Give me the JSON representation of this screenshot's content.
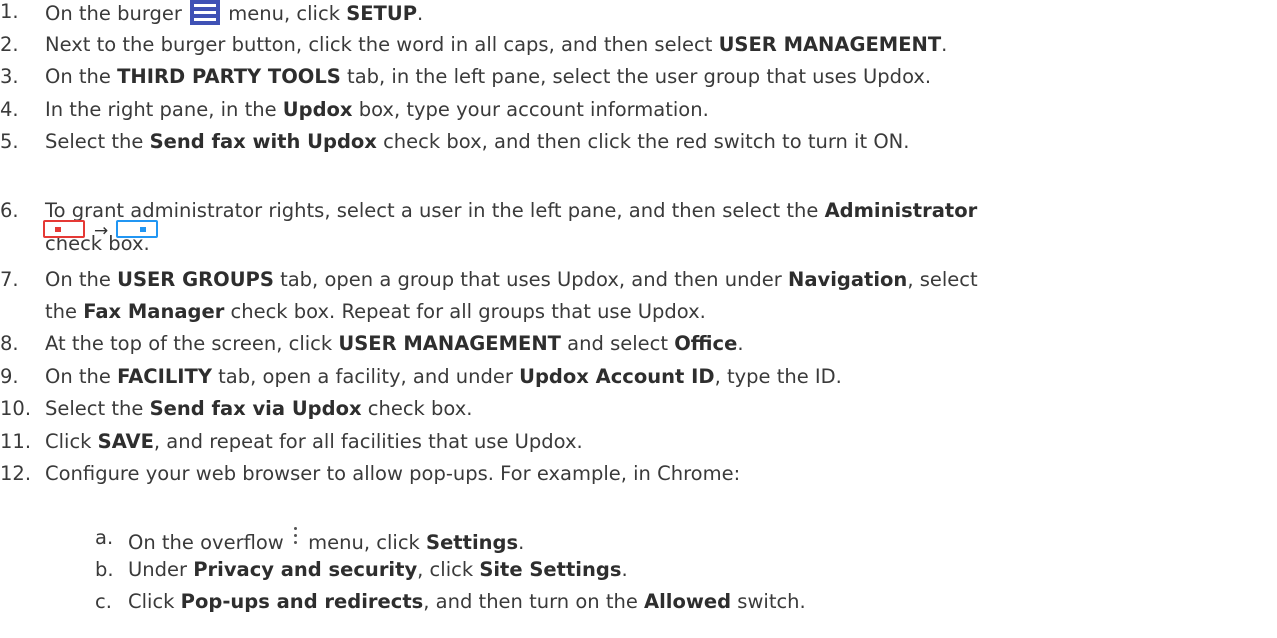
{
  "steps": [
    {
      "n": "1.",
      "parts": [
        "On the burger ",
        "[icon]",
        " menu, click ",
        "<b>SETUP</b>",
        "."
      ]
    },
    {
      "n": "2.",
      "parts": [
        "Next to the burger button, click the word in all caps, and then select ",
        "<b>USER MANAGEMENT</b>",
        "."
      ]
    },
    {
      "n": "3.",
      "parts": [
        "On the ",
        "<b>THIRD PARTY TOOLS</b>",
        " tab, in the left pane, select the user group that uses Updox."
      ]
    },
    {
      "n": "4.",
      "parts": [
        "In the right pane, in the ",
        "<b>Updox</b>",
        " box, type your account information."
      ]
    },
    {
      "n": "5.",
      "parts": [
        "Select the ",
        "<b>Send fax with Updox</b>",
        " check box, and then click the red switch to turn it ON."
      ]
    },
    {
      "n": "6.",
      "lines": [
        [
          "To grant administrator rights, select a user in the left pane, and then select the ",
          "<b>Administrator</b>"
        ],
        [
          "check box."
        ]
      ]
    },
    {
      "n": "7.",
      "lines": [
        [
          "On the ",
          "<b>USER GROUPS</b>",
          " tab, open a group that uses Updox, and then under ",
          "<b>Navigation</b>",
          ", select"
        ],
        [
          "the ",
          "<b>Fax Manager</b>",
          " check box. Repeat for all groups that use Updox."
        ]
      ]
    },
    {
      "n": "8.",
      "parts": [
        "At the top of the screen, click ",
        "<b>USER MANAGEMENT</b>",
        " and select ",
        "<b>Office</b>",
        "."
      ]
    },
    {
      "n": "9.",
      "parts": [
        "On the ",
        "<b>FACILITY</b>",
        " tab, open a facility, and under ",
        "<b>Updox Account ID</b>",
        ", type the ID."
      ]
    },
    {
      "n": "10.",
      "parts": [
        "Select the ",
        "<b>Send fax via Updox</b>",
        " check box."
      ]
    },
    {
      "n": "11.",
      "parts": [
        "Click ",
        "<b>SAVE</b>",
        ", and repeat for all facilities that use Updox."
      ]
    },
    {
      "n": "12.",
      "parts": [
        "Configure your web browser to allow pop-ups. For example, in Chrome:"
      ]
    }
  ],
  "substeps": [
    {
      "n": "a.",
      "parts": [
        "On the overflow ",
        "[icon]",
        " menu, click ",
        "<b>Settings</b>",
        "."
      ]
    },
    {
      "n": "b.",
      "parts": [
        "Under ",
        "<b>Privacy and security</b>",
        ", click ",
        "<b>Site Settings</b>",
        "."
      ]
    },
    {
      "n": "c.",
      "parts": [
        "Click ",
        "<b>Pop-ups and redirects</b>",
        ", and then turn on the ",
        "<b>Allowed</b>",
        " switch."
      ]
    }
  ],
  "arrow": "→",
  "icons": {
    "burger": "burger-menu-icon",
    "overflow": "overflow-menu-icon",
    "switch_off": "switch-off-icon",
    "switch_on": "switch-on-icon"
  },
  "colors": {
    "burger": "#3f51b5",
    "switch_off": "#e53935",
    "switch_on": "#2196f3"
  }
}
